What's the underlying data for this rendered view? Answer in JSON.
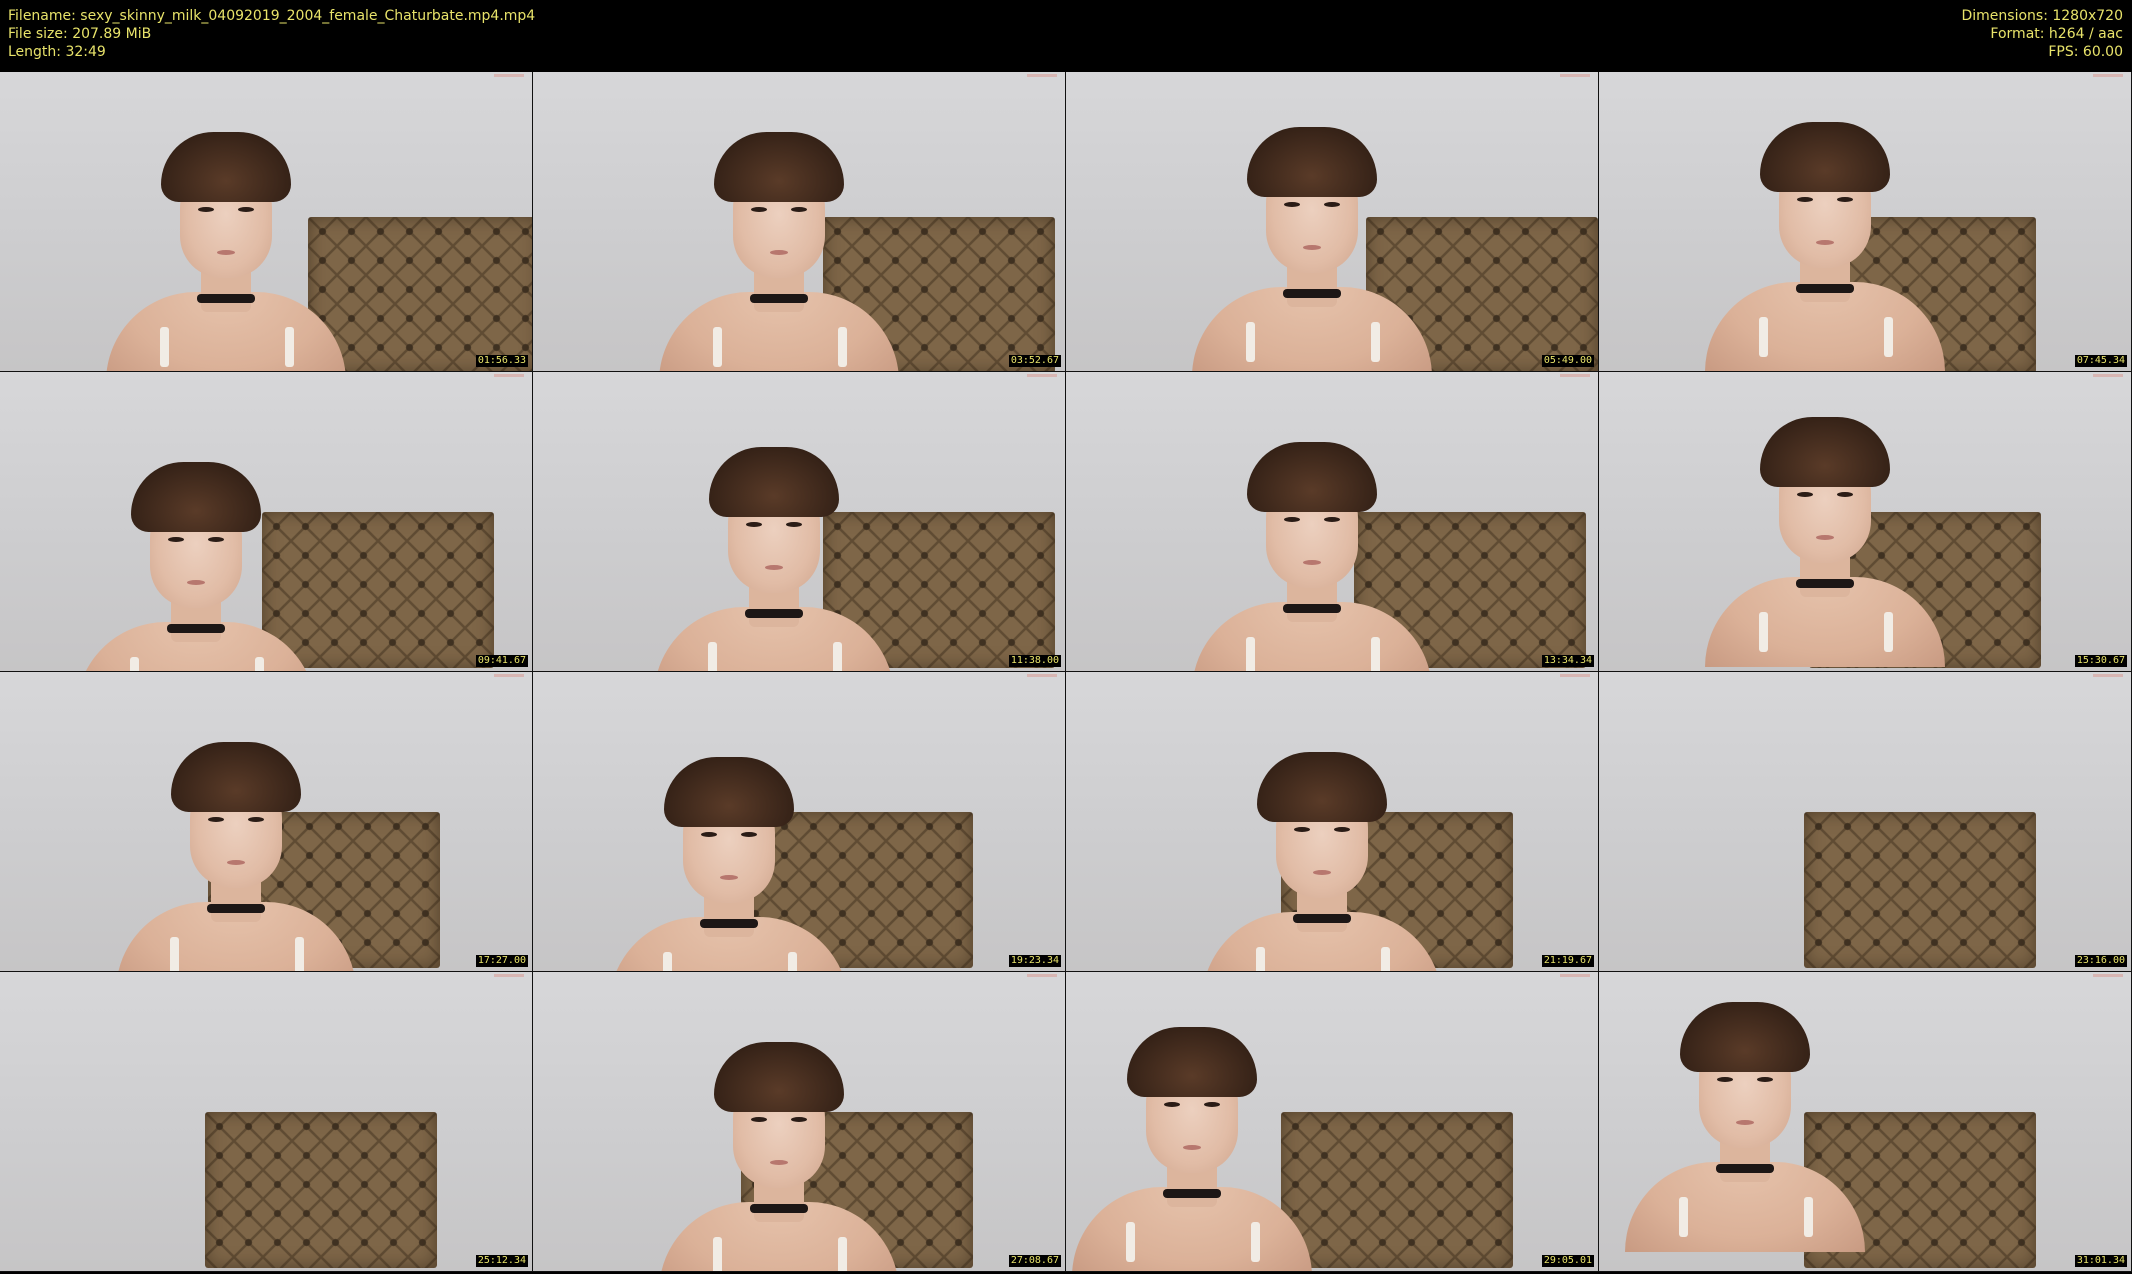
{
  "header": {
    "filename_line": "Filename: sexy_skinny_milk_04092019_2004_female_Chaturbate.mp4.mp4",
    "filesize_line": "File size: 207.89 MiB",
    "length_line": "Length: 32:49",
    "dimensions_line": "Dimensions: 1280x720",
    "format_line": "Format: h264 / aac",
    "fps_line": "FPS: 60.00"
  },
  "thumbnails": [
    {
      "timestamp": "01:56.33"
    },
    {
      "timestamp": "03:52.67"
    },
    {
      "timestamp": "05:49.00"
    },
    {
      "timestamp": "07:45.34"
    },
    {
      "timestamp": "09:41.67"
    },
    {
      "timestamp": "11:38.00"
    },
    {
      "timestamp": "13:34.34"
    },
    {
      "timestamp": "15:30.67"
    },
    {
      "timestamp": "17:27.00"
    },
    {
      "timestamp": "19:23.34"
    },
    {
      "timestamp": "21:19.67"
    },
    {
      "timestamp": "23:16.00"
    },
    {
      "timestamp": "25:12.34"
    },
    {
      "timestamp": "27:08.67"
    },
    {
      "timestamp": "29:05.01"
    },
    {
      "timestamp": "31:01.34"
    }
  ],
  "colors": {
    "text": "#e8e36a",
    "background": "#000000",
    "headboard": "#7e6648",
    "wall": "#d2d2d4"
  }
}
